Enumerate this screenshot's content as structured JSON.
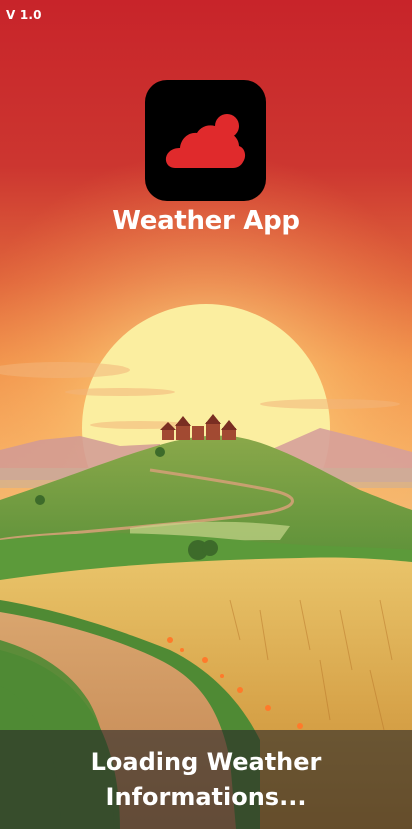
{
  "app": {
    "version": "V 1.0",
    "title": "Weather App",
    "icon": "cloud-sun-icon",
    "loading_text": "Loading Weather Informations..."
  },
  "colors": {
    "top_bg": "#c8242a",
    "icon_bg": "#000000",
    "icon_glyph": "#e02a2c",
    "sun": "#fbeea0",
    "text": "#ffffff"
  }
}
